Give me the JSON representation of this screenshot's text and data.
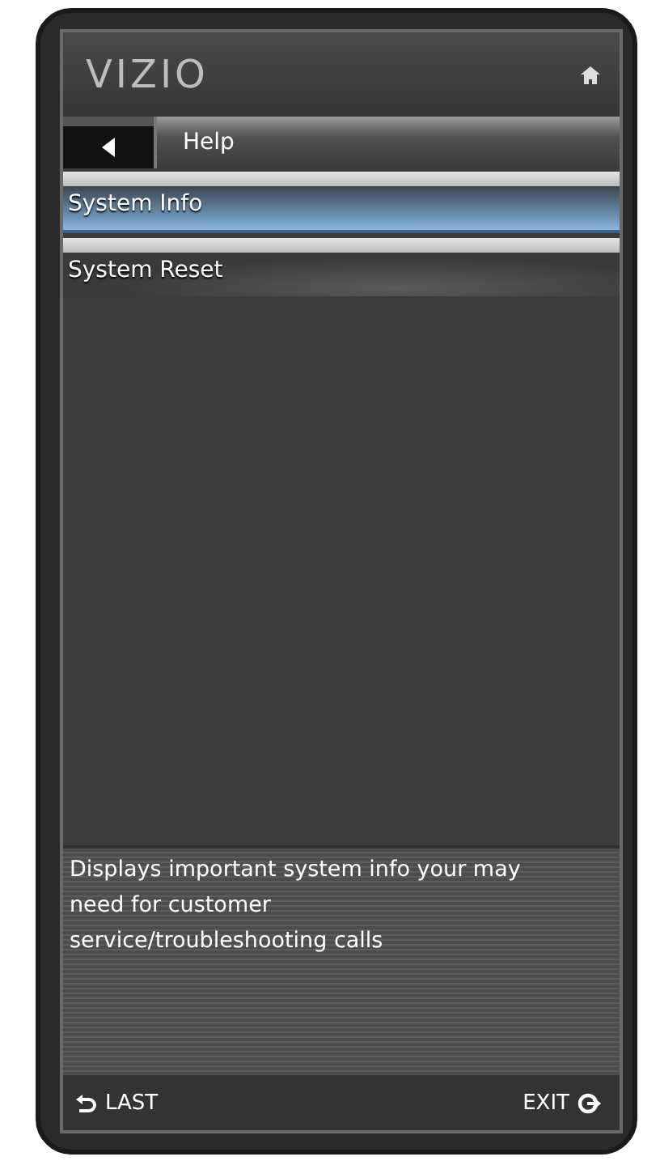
{
  "header": {
    "logo": "VIZIO"
  },
  "breadcrumb": {
    "title": "Help"
  },
  "menu_items": [
    {
      "label": "System Info",
      "selected": true
    },
    {
      "label": "System Reset",
      "selected": false
    }
  ],
  "description": "Displays important system info your may need for customer service/troubleshooting calls",
  "footer": {
    "last": "LAST",
    "exit": "EXIT"
  }
}
